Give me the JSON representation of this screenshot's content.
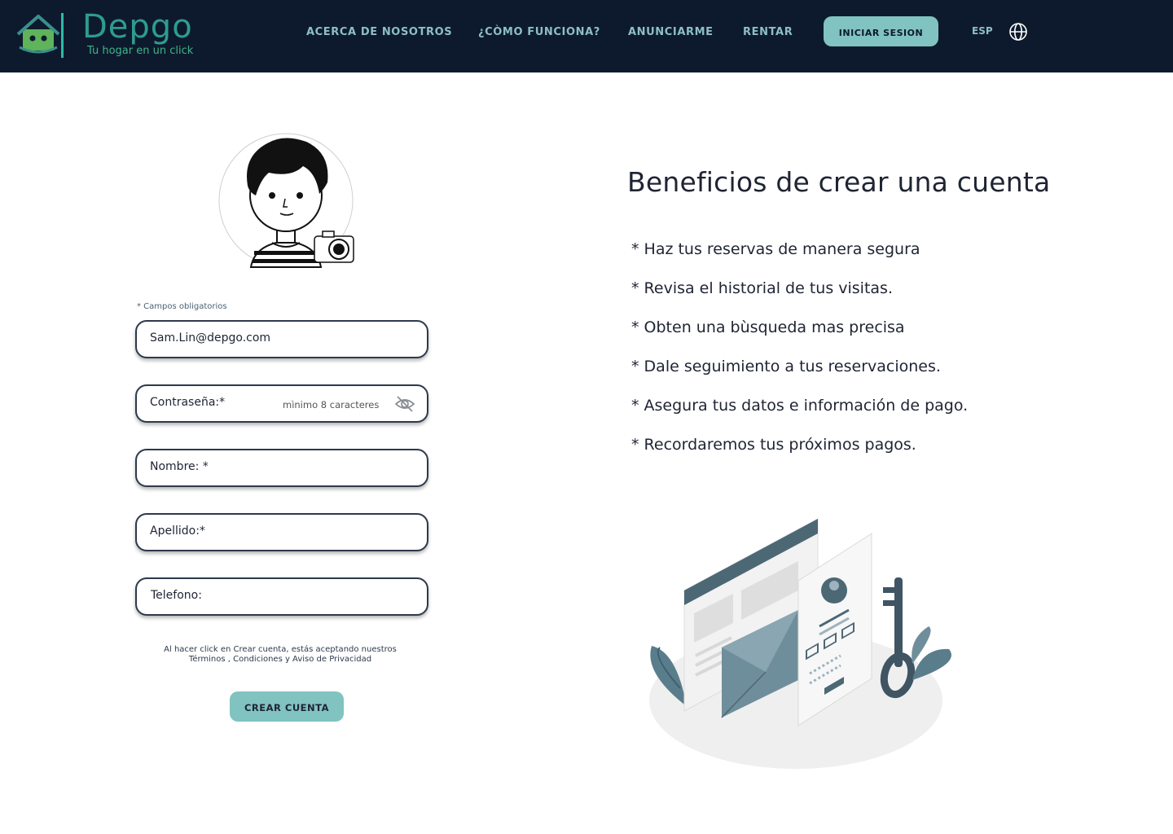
{
  "header": {
    "brand_name": "Depgo",
    "brand_tagline": "Tu hogar en un click",
    "nav": [
      "ACERCA DE NOSOTROS",
      "¿CÒMO FUNCIONA?",
      "ANUNCIARME",
      "RENTAR"
    ],
    "login_label": "INICIAR SESION",
    "language": "ESP"
  },
  "form": {
    "required_note": "* Campos obligatorios",
    "fields": [
      {
        "label": "Sam.Lin@depgo.com"
      },
      {
        "label": "Contraseña:*",
        "hint": "mìnimo 8 caracteres"
      },
      {
        "label": "Nombre: *"
      },
      {
        "label": "Apellido:*"
      },
      {
        "label": "Telefono:"
      }
    ],
    "terms_line1": "Al hacer click en Crear cuenta, estás aceptando nuestros",
    "terms_line2": "Términos , Condiciones y Aviso de Privacidad",
    "create_label": "CREAR CUENTA"
  },
  "benefits": {
    "title": "Beneficios de crear una cuenta",
    "items": [
      "* Haz tus reservas de manera segura",
      "* Revisa el historial de tus visitas.",
      "* Obten una bùsqueda mas precisa",
      "* Dale seguimiento a tus reservaciones.",
      "* Asegura tus datos e información de pago.",
      "* Recordaremos tus próximos pagos."
    ]
  },
  "colors": {
    "navbar": "#0d1a2d",
    "accent": "#80c3c0",
    "brand": "#2e9c8e",
    "nav_text": "#8dbfc4"
  },
  "icons": [
    "house-logo-icon",
    "globe-icon",
    "eye-off-icon",
    "camera-icon"
  ]
}
